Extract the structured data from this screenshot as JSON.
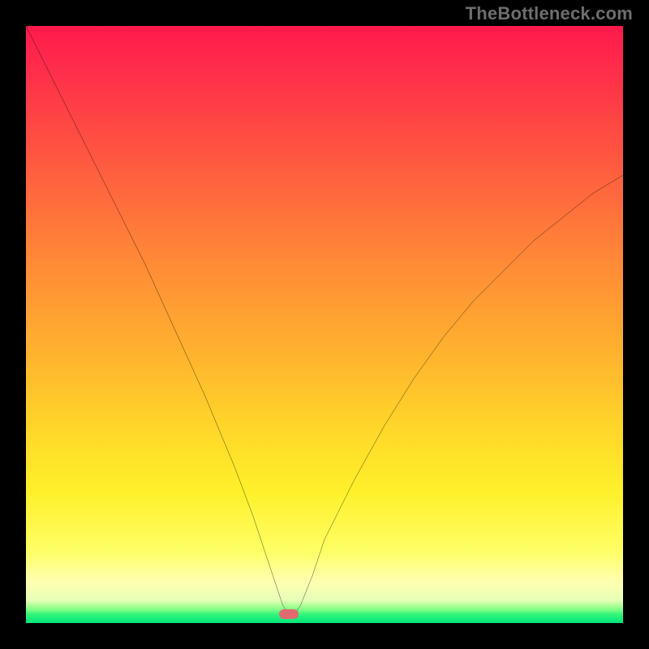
{
  "watermark": "TheBottleneck.com",
  "colors": {
    "black_border": "#000000",
    "marker": "#e06a70",
    "curve": "#000000",
    "gradient_top": "#ff1a4d",
    "gradient_bottom": "#00e67a"
  },
  "chart_data": {
    "type": "line",
    "title": "",
    "xlabel": "",
    "ylabel": "",
    "xlim": [
      0,
      100
    ],
    "ylim": [
      0,
      100
    ],
    "grid": false,
    "legend": false,
    "annotations": [
      "TheBottleneck.com"
    ],
    "marker": {
      "x": 44,
      "y": 1.5
    },
    "series": [
      {
        "name": "bottleneck-curve",
        "x": [
          0,
          5,
          10,
          15,
          20,
          25,
          30,
          35,
          38,
          40,
          41,
          42,
          43,
          44,
          45,
          46,
          48,
          50,
          55,
          60,
          65,
          70,
          75,
          80,
          85,
          90,
          95,
          100
        ],
        "values": [
          100,
          90,
          80,
          70,
          60,
          49,
          38,
          26,
          18,
          12,
          9,
          6,
          3,
          1.5,
          1.5,
          3,
          8,
          14,
          24,
          33,
          41,
          48,
          54,
          59,
          64,
          68,
          72,
          75
        ]
      }
    ]
  }
}
